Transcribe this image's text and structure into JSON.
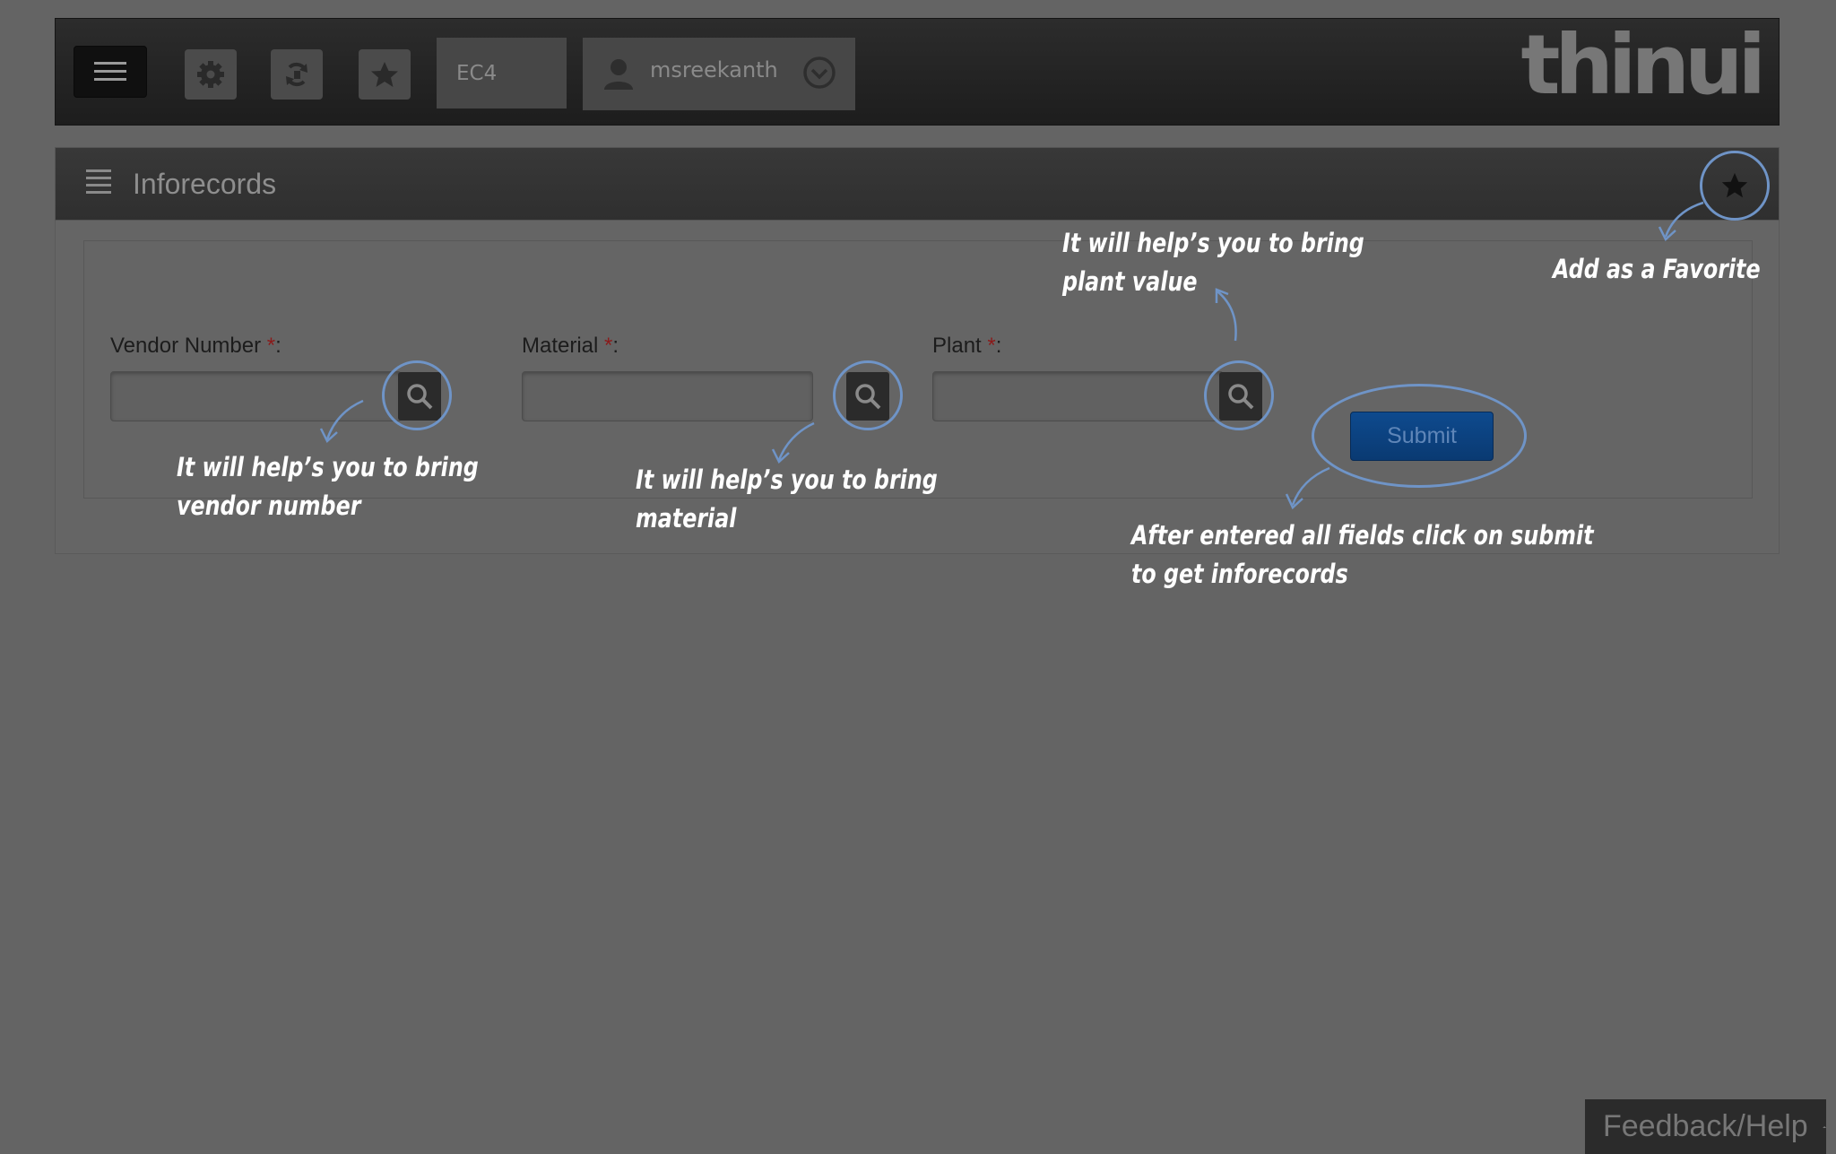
{
  "topbar": {
    "system_id": "EC4",
    "username": "msreekanth",
    "logo_text": "thinui",
    "icons": [
      "hamburger-menu-icon",
      "gear-icon",
      "refresh-icon",
      "star-icon",
      "user-icon",
      "chevron-down-circle-icon"
    ]
  },
  "panel": {
    "title": "Inforecords"
  },
  "form": {
    "fields": [
      {
        "label": "Vendor Number",
        "required_mark": "*",
        "suffix": ":"
      },
      {
        "label": "Material",
        "required_mark": "*",
        "suffix": ":"
      },
      {
        "label": "Plant",
        "required_mark": "*",
        "suffix": ":"
      }
    ],
    "submit_label": "Submit"
  },
  "annotations": {
    "vendor_line1": "It will help’s you to bring",
    "vendor_line2": "vendor number",
    "material_line1": "It will help’s you to bring",
    "material_line2": "material",
    "plant_line1": "It will help’s you to bring",
    "plant_line2": "plant value",
    "favorite": "Add as a Favorite",
    "submit_line1": "After entered all fields click on submit",
    "submit_line2": "to get inforecords"
  },
  "footer": {
    "feedback_label": "Feedback/Help"
  },
  "colors": {
    "overlay_bg": "#646464",
    "callout_ring": "#6f94c7",
    "submit_bg": "#0e4a8e",
    "required": "#8b1a1a"
  }
}
